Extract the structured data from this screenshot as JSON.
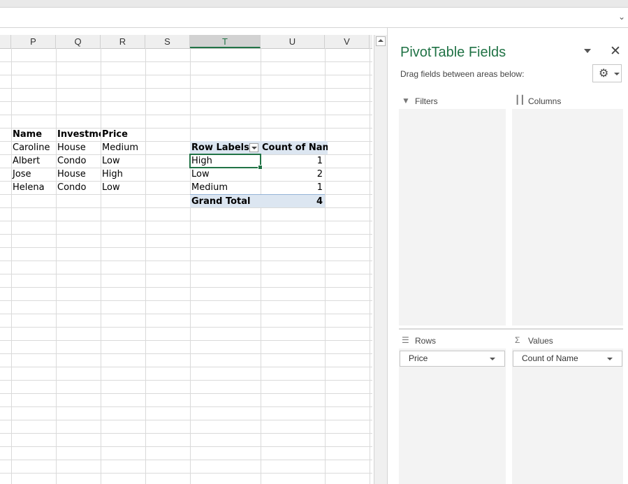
{
  "formula_bar": {
    "collapse_icon": "chevron-down-icon"
  },
  "columns": [
    "P",
    "Q",
    "R",
    "S",
    "T",
    "U",
    "V"
  ],
  "selected_column": "T",
  "source_table": {
    "headers": [
      "Name",
      "Investmer",
      "Price"
    ],
    "rows": [
      [
        "Caroline",
        "House",
        "Medium"
      ],
      [
        "Albert",
        "Condo",
        "Low"
      ],
      [
        "Jose",
        "House",
        "High"
      ],
      [
        "Helena",
        "Condo",
        "Low"
      ]
    ]
  },
  "pivot": {
    "row_labels_header": "Row Labels",
    "values_header": "Count of Name",
    "rows": [
      {
        "label": "High",
        "value": "1"
      },
      {
        "label": "Low",
        "value": "2"
      },
      {
        "label": "Medium",
        "value": "1"
      }
    ],
    "total_label": "Grand Total",
    "total_value": "4",
    "active_cell": "High"
  },
  "pane": {
    "title": "PivotTable Fields",
    "subtitle": "Drag fields between areas below:",
    "areas": {
      "filters": "Filters",
      "columns": "Columns",
      "rows": "Rows",
      "values": "Values"
    },
    "rows_field": "Price",
    "values_field": "Count of Name",
    "icons": {
      "filters": "filter-icon",
      "columns": "columns-icon",
      "rows": "rows-icon",
      "values": "sigma-icon",
      "settings": "gear-icon",
      "close": "close-icon"
    }
  },
  "colors": {
    "accent": "#217346",
    "pivot_header_fill": "#dce6f1"
  }
}
